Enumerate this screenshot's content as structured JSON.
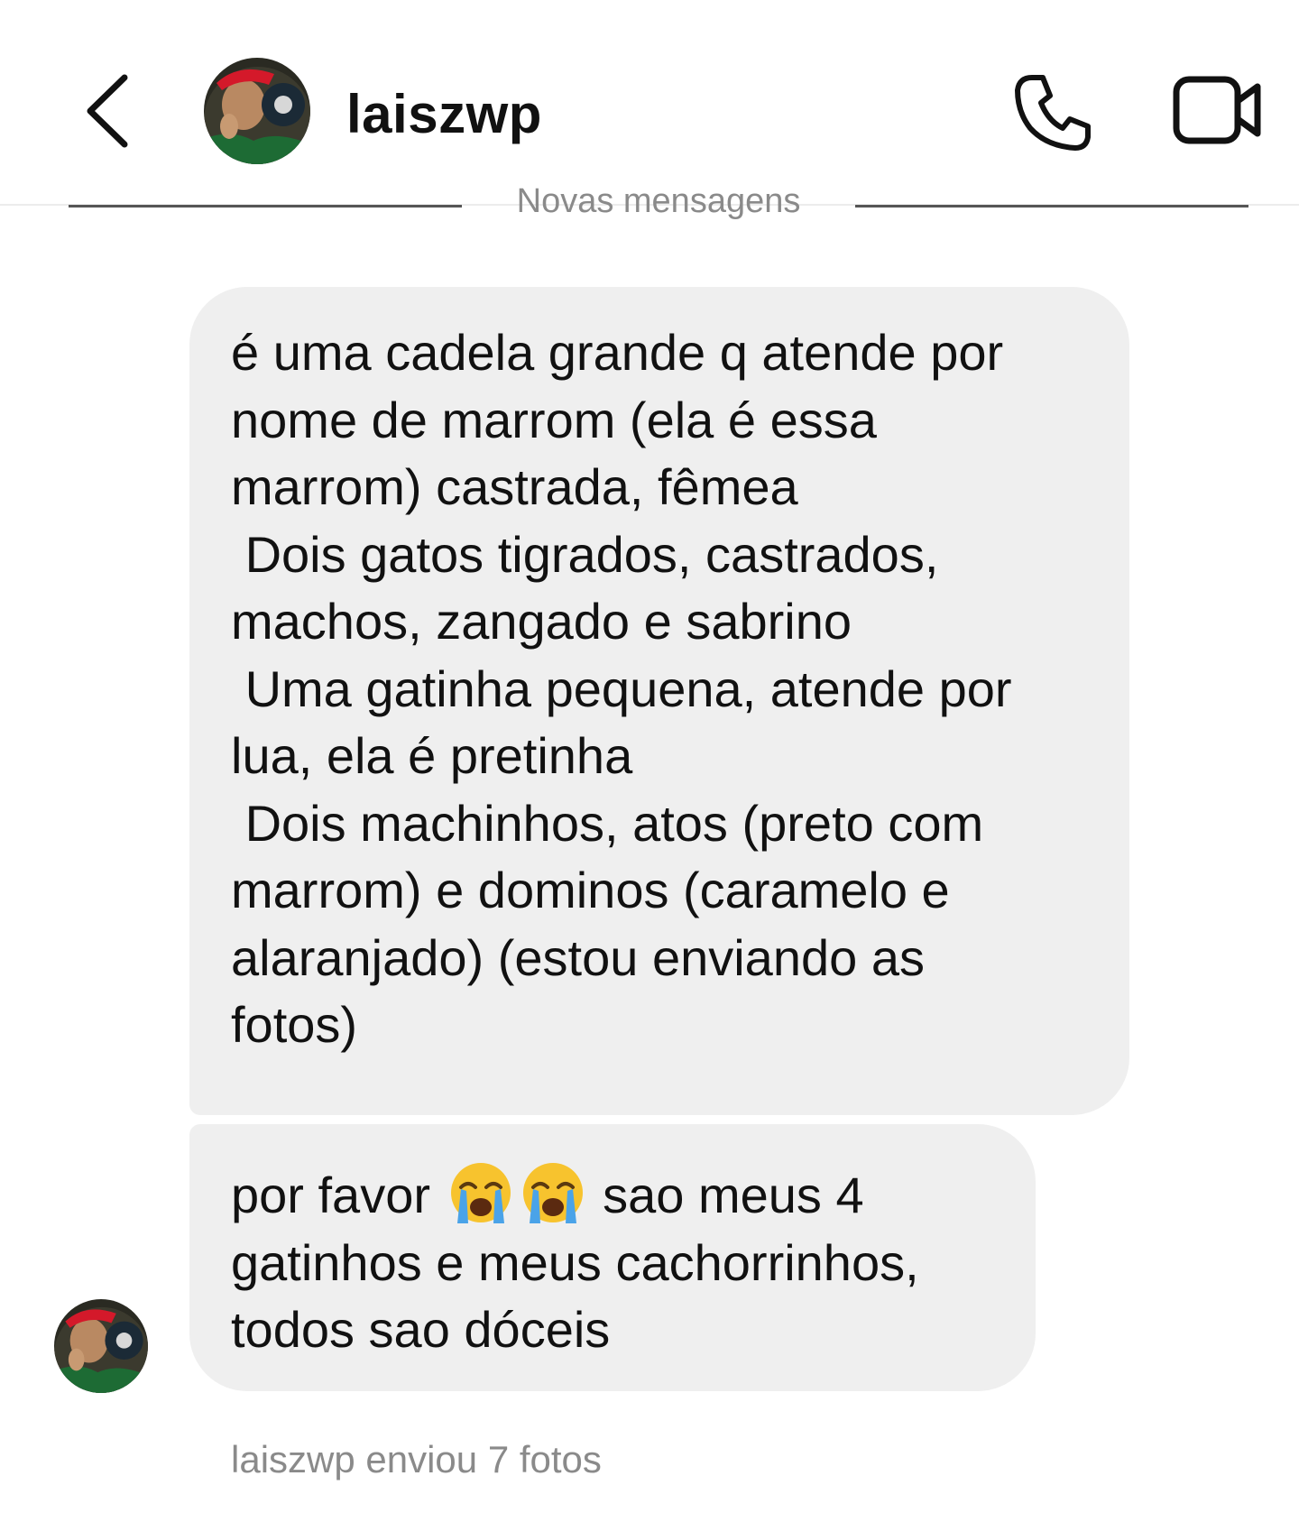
{
  "header": {
    "username": "laiszwp",
    "icons": {
      "back": "chevron-left-icon",
      "call": "phone-icon",
      "video": "video-camera-icon"
    }
  },
  "divider": {
    "label": "Novas mensagens"
  },
  "messages": [
    {
      "text": "é uma cadela grande q atende por\nnome de marrom (ela é essa\nmarrom) castrada, fêmea\n Dois gatos tigrados, castrados,\nmachos, zangado e sabrino\n Uma gatinha pequena, atende por\nlua, ela é pretinha\n Dois machinhos, atos (preto com\nmarrom) e dominos (caramelo e\nalaranjado) (estou enviando as\nfotos)"
    },
    {
      "text_before": "por favor",
      "emoji": "loudly-crying-face",
      "text_after": " sao meus 4",
      "text_rest": "gatinhos e meus cachorrinhos,\ntodos sao dóceis"
    }
  ],
  "sent_info": "laiszwp enviou 7 fotos",
  "colors": {
    "bubble": "#efefef",
    "muted_text": "#8a8a8a",
    "divider_line": "#555555"
  }
}
